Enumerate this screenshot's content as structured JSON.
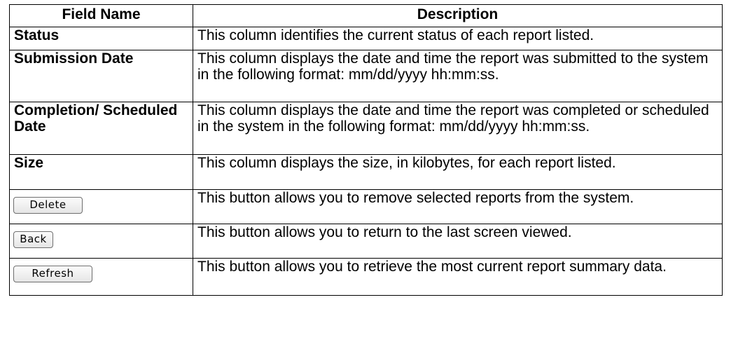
{
  "table": {
    "headers": [
      "Field Name",
      "Description"
    ],
    "rows": [
      {
        "field": "Status",
        "description": "This column identifies the current status of each report listed."
      },
      {
        "field": "Submission Date",
        "description": "This column displays the date and time the report was submitted to the system in the following format:  mm/dd/yyyy hh:mm:ss."
      },
      {
        "field": "Completion/ Scheduled Date",
        "description": "This column displays the date and time the report was completed or scheduled in the system in the following format: mm/dd/yyyy hh:mm:ss."
      },
      {
        "field": "Size",
        "description": "This column displays the size, in kilobytes, for each report listed."
      },
      {
        "button": "Delete",
        "description": "This button allows you to remove selected reports from the system."
      },
      {
        "button": "Back",
        "description": "This button allows you to return to the last screen viewed."
      },
      {
        "button": "Refresh",
        "description": "This button allows you to retrieve the most current report summary data."
      }
    ]
  }
}
